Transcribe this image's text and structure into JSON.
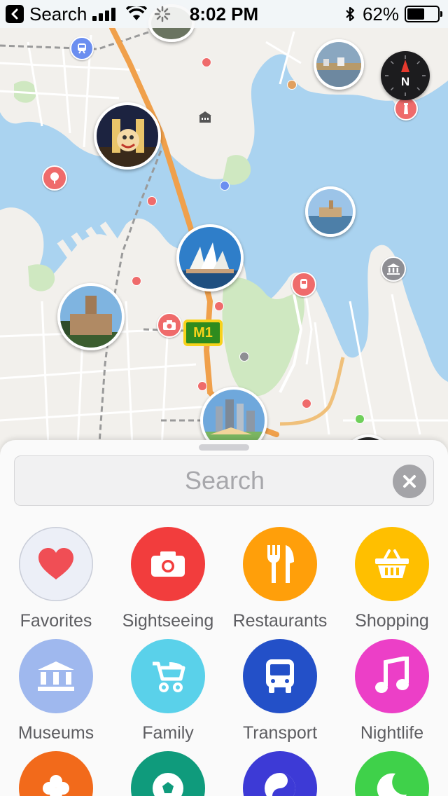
{
  "status_bar": {
    "back_label": "Search",
    "time": "8:02 PM",
    "battery": "62%",
    "battery_level": 0.62
  },
  "map": {
    "highway_shield": "M1",
    "compass_label": "N",
    "colors": {
      "water": "#aad3f0",
      "land": "#f2f0ec",
      "park": "#cfe8c1",
      "motorway": "#f0a04b",
      "poi_red": "#ef6b6b",
      "poi_gray": "#8e8e93",
      "poi_blue": "#6b8ef0"
    }
  },
  "search": {
    "placeholder": "Search"
  },
  "categories": [
    {
      "label": "Favorites",
      "icon": "heart-icon",
      "color": "#eceff7"
    },
    {
      "label": "Sightseeing",
      "icon": "camera-icon",
      "color": "#f23d3d"
    },
    {
      "label": "Restaurants",
      "icon": "fork-knife-icon",
      "color": "#ff9f0a"
    },
    {
      "label": "Shopping",
      "icon": "basket-icon",
      "color": "#ffbf00"
    },
    {
      "label": "Museums",
      "icon": "museum-icon",
      "color": "#9fb8ee"
    },
    {
      "label": "Family",
      "icon": "stroller-icon",
      "color": "#5ad1ea"
    },
    {
      "label": "Transport",
      "icon": "bus-icon",
      "color": "#2350c8"
    },
    {
      "label": "Nightlife",
      "icon": "music-note-icon",
      "color": "#ec3fc7"
    },
    {
      "label": "",
      "icon": "flower-icon",
      "color": "#f26a1b"
    },
    {
      "label": "",
      "icon": "soccer-ball-icon",
      "color": "#0f9b7c"
    },
    {
      "label": "",
      "icon": "yin-yang-icon",
      "color": "#3d3ad6"
    },
    {
      "label": "",
      "icon": "moon-icon",
      "color": "#3fd14a"
    }
  ]
}
